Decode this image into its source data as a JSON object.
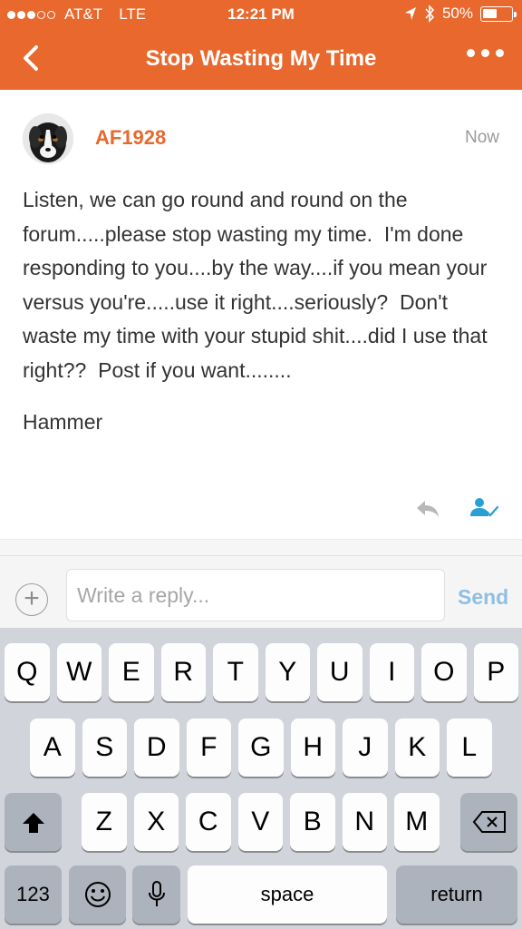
{
  "status_bar": {
    "carrier": "AT&T",
    "network": "LTE",
    "time": "12:21 PM",
    "battery_text": "50%",
    "battery_level": 0.5,
    "signal_bars_filled": 3,
    "signal_bars_total": 5
  },
  "nav": {
    "title": "Stop Wasting My Time",
    "back_icon": "chevron-left-icon",
    "more_icon": "more-dots-icon"
  },
  "post": {
    "author": "AF1928",
    "timestamp": "Now",
    "body": "Listen, we can go round and round on the forum.....please stop wasting my time.  I'm done responding to you....by the way....if you mean your versus you're.....use it right....seriously?  Don't waste my time with your stupid shit....did I use that right??  Post if you want........",
    "signature": "Hammer",
    "reply_icon": "reply-arrow-icon",
    "like_icon": "user-check-icon"
  },
  "reply_bar": {
    "placeholder": "Write a reply...",
    "value": "",
    "send_label": "Send",
    "add_icon": "plus-circle-icon"
  },
  "keyboard": {
    "row1": [
      "Q",
      "W",
      "E",
      "R",
      "T",
      "Y",
      "U",
      "I",
      "O",
      "P"
    ],
    "row2": [
      "A",
      "S",
      "D",
      "F",
      "G",
      "H",
      "J",
      "K",
      "L"
    ],
    "row3": [
      "Z",
      "X",
      "C",
      "V",
      "B",
      "N",
      "M"
    ],
    "shift_icon": "shift-arrow-icon",
    "delete_icon": "backspace-icon",
    "numbers_label": "123",
    "emoji_icon": "emoji-icon",
    "mic_icon": "microphone-icon",
    "space_label": "space",
    "return_label": "return"
  },
  "colors": {
    "brand": "#e8682d",
    "send_disabled": "#8ebfe4",
    "icon_blue": "#2a9fd6",
    "icon_gray": "#b8b8b8"
  }
}
